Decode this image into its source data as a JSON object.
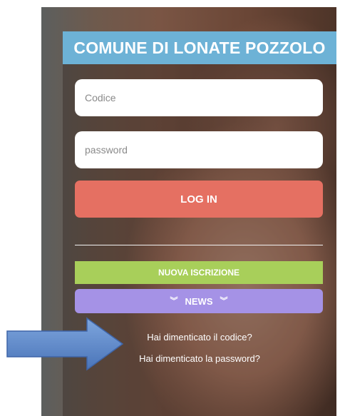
{
  "header": {
    "title": "COMUNE DI LONATE POZZOLO"
  },
  "form": {
    "code_placeholder": "Codice",
    "password_placeholder": "password",
    "login_label": "LOG IN"
  },
  "actions": {
    "register_label": "NUOVA ISCRIZIONE",
    "news_label": "NEWS",
    "news_icon": "double-chevron-down-icon"
  },
  "links": {
    "forgot_code": "Hai dimenticato il codice?",
    "forgot_password": "Hai dimenticato la password?"
  },
  "colors": {
    "header": "#6db2d6",
    "login": "#e57062",
    "register": "#a8cf5a",
    "news": "#a592e6",
    "arrow": "#5b84c4"
  },
  "annotation": {
    "arrow_icon": "right-arrow-icon"
  }
}
